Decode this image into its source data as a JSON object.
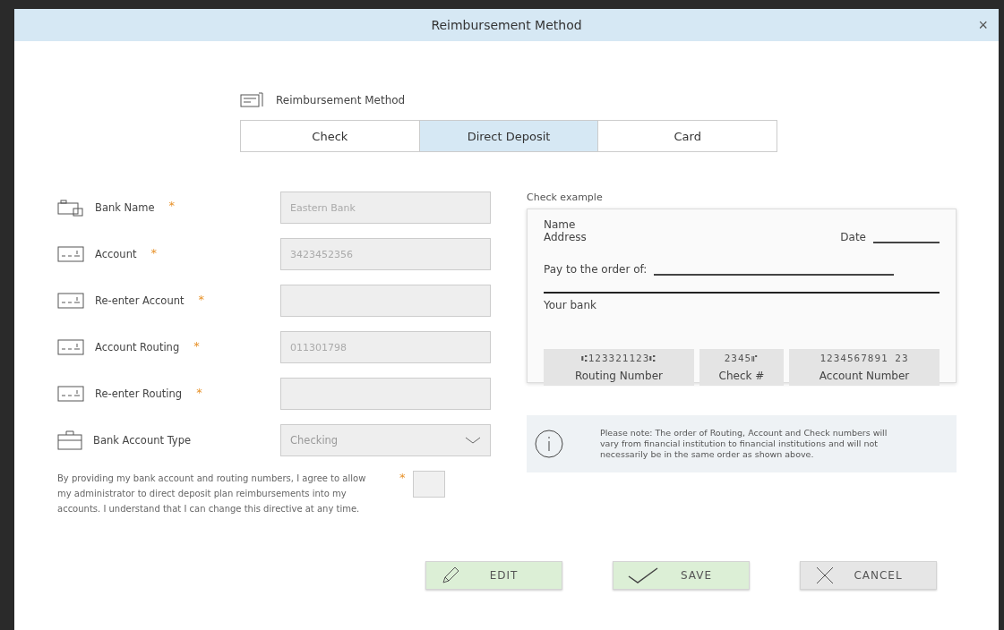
{
  "window": {
    "title": "Reimbursement Method",
    "close": "×"
  },
  "section": {
    "title": "Reimbursement Method"
  },
  "tabs": [
    {
      "label": "Check",
      "selected": false
    },
    {
      "label": "Direct Deposit",
      "selected": true
    },
    {
      "label": "Card",
      "selected": false
    }
  ],
  "fields": [
    {
      "kind": "input",
      "label": "Bank Name",
      "required_mark": "*",
      "value": "Eastern Bank"
    },
    {
      "kind": "input",
      "label": "Account",
      "required_mark": "*",
      "value": "3423452356"
    },
    {
      "kind": "input",
      "label": "Re-enter Account",
      "required_mark": "*"
    },
    {
      "kind": "input",
      "label": "Account Routing",
      "required_mark": "*",
      "value": "011301798"
    },
    {
      "kind": "input",
      "label": "Re-enter Routing",
      "required_mark": "*"
    },
    {
      "kind": "select",
      "label": "Bank Account Type",
      "value": "Checking"
    }
  ],
  "consent": {
    "text": "By providing my bank account and routing numbers, I agree to allow my administrator to direct deposit plan reimbursements into my accounts. I understand that I can change this directive at any time.",
    "required_mark": "*",
    "checked": false
  },
  "check_example": {
    "title": "Check example",
    "name": "Name",
    "address": "Address",
    "date": "Date",
    "pay_to": "Pay to the order of:",
    "bank": "Your bank",
    "numbers": [
      {
        "digits": "⑆123321123⑆",
        "label": "Routing Number"
      },
      {
        "digits": "2345⑈",
        "label": "Check #"
      },
      {
        "digits": "1234567891 23",
        "label": "Account Number"
      }
    ]
  },
  "note": {
    "text": "Please note: The order of Routing, Account and Check numbers will vary from financial institution to financial institutions and will not necessarily be in the same order as shown above."
  },
  "buttons": [
    {
      "kind": "edit",
      "label": "EDIT",
      "color": "#dcefd6"
    },
    {
      "kind": "save",
      "label": "SAVE",
      "color": "#dcefd6"
    },
    {
      "kind": "cancel",
      "label": "CANCEL",
      "color": "#e6e6e6"
    }
  ]
}
